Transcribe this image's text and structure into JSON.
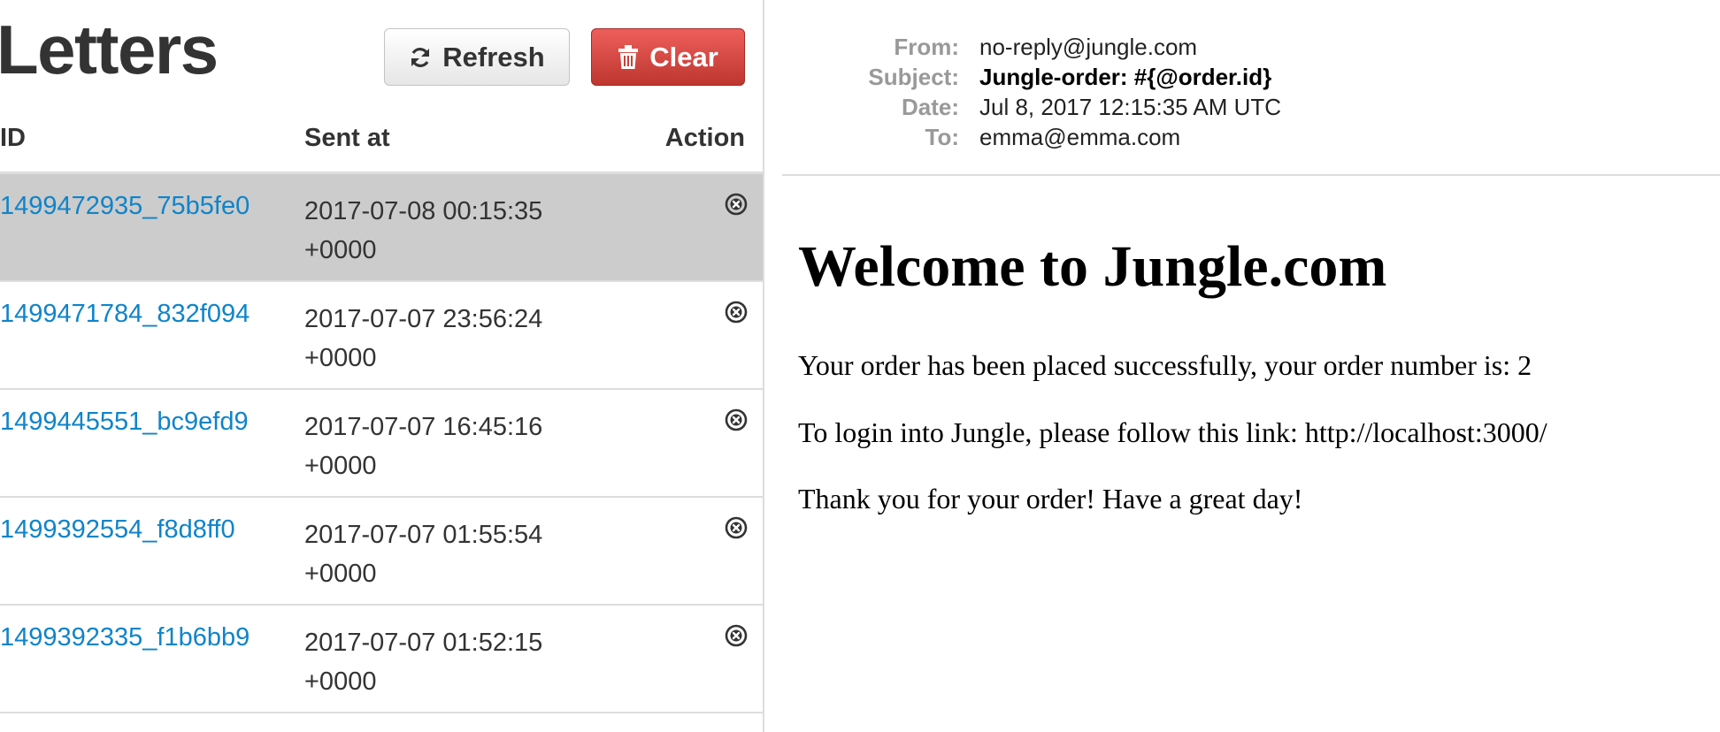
{
  "app": {
    "title": "Letters",
    "refresh_label": "Refresh",
    "clear_label": "Clear"
  },
  "table": {
    "headers": {
      "id": "ID",
      "sent_at": "Sent at",
      "action": "Action"
    },
    "rows": [
      {
        "id": "1499472935_75b5fe0",
        "date": "2017-07-08 00:15:35",
        "tz": "+0000",
        "selected": true
      },
      {
        "id": "1499471784_832f094",
        "date": "2017-07-07 23:56:24",
        "tz": "+0000",
        "selected": false
      },
      {
        "id": "1499445551_bc9efd9",
        "date": "2017-07-07 16:45:16",
        "tz": "+0000",
        "selected": false
      },
      {
        "id": "1499392554_f8d8ff0",
        "date": "2017-07-07 01:55:54",
        "tz": "+0000",
        "selected": false
      },
      {
        "id": "1499392335_f1b6bb9",
        "date": "2017-07-07 01:52:15",
        "tz": "+0000",
        "selected": false
      }
    ],
    "row_action_icon": "remove-circle-icon"
  },
  "letter": {
    "headers": {
      "from_label": "From:",
      "from": "no-reply@jungle.com",
      "subject_label": "Subject:",
      "subject": "Jungle-order: #{@order.id}",
      "date_label": "Date:",
      "date": "Jul 8, 2017 12:15:35 AM UTC",
      "to_label": "To:",
      "to": "emma@emma.com"
    },
    "body": {
      "heading": "Welcome to Jungle.com",
      "paragraphs": [
        "Your order has been placed successfully, your order number is: 2",
        "To login into Jungle, please follow this link: http://localhost:3000/",
        "Thank you for your order! Have a great day!"
      ]
    }
  },
  "colors": {
    "link": "#0f84c9",
    "danger": "#da4f49",
    "selected_row": "#cccccc",
    "muted_label": "#999999"
  },
  "icons": {
    "refresh": "refresh-icon",
    "clear": "trash-icon"
  }
}
